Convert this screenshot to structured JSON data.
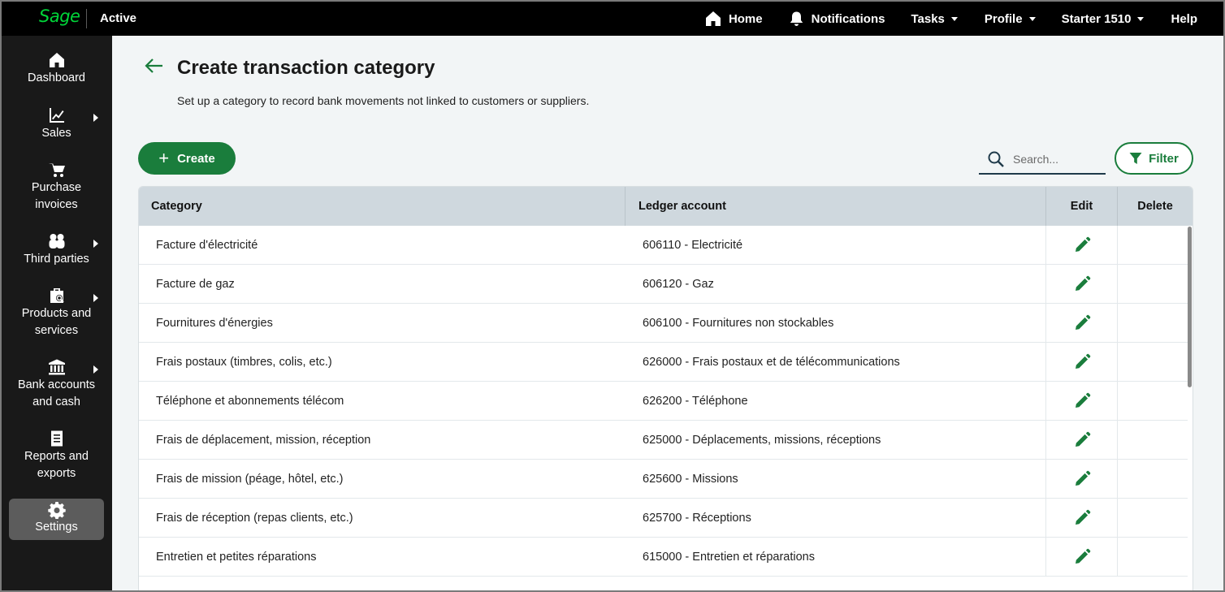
{
  "app": {
    "logo_text": "Sage",
    "state_label": "Active",
    "brand_color": "#00d639",
    "accent_color": "#1a7d3c"
  },
  "topnav": {
    "home": "Home",
    "notifications": "Notifications",
    "tasks": "Tasks",
    "profile": "Profile",
    "company": "Starter 1510",
    "help": "Help"
  },
  "sidebar": {
    "items": [
      {
        "label": "Dashboard",
        "icon": "home-icon"
      },
      {
        "label": "Sales",
        "icon": "chart-icon"
      },
      {
        "label": "Purchase invoices",
        "icon": "cart-icon"
      },
      {
        "label": "Third parties",
        "icon": "people-icon"
      },
      {
        "label": "Products and services",
        "icon": "products-icon"
      },
      {
        "label": "Bank accounts and cash",
        "icon": "bank-icon"
      },
      {
        "label": "Reports and exports",
        "icon": "document-icon"
      },
      {
        "label": "Settings",
        "icon": "gear-icon"
      }
    ]
  },
  "page": {
    "title": "Create transaction category",
    "subtitle": "Set up a category to record bank movements not linked to customers or suppliers."
  },
  "toolbar": {
    "create_label": "Create",
    "search_placeholder": "Search...",
    "filter_label": "Filter"
  },
  "table": {
    "headers": {
      "category": "Category",
      "ledger": "Ledger account",
      "edit": "Edit",
      "delete": "Delete"
    },
    "rows": [
      {
        "category": "Facture d'électricité",
        "ledger": "606110 - Electricité"
      },
      {
        "category": "Facture de gaz",
        "ledger": "606120 - Gaz"
      },
      {
        "category": "Fournitures d'énergies",
        "ledger": "606100 - Fournitures non stockables"
      },
      {
        "category": "Frais postaux (timbres, colis, etc.)",
        "ledger": "626000 - Frais postaux et de télécommunications"
      },
      {
        "category": "Téléphone et abonnements télécom",
        "ledger": "626200 - Téléphone"
      },
      {
        "category": "Frais de déplacement, mission, réception",
        "ledger": "625000 - Déplacements, missions, réceptions"
      },
      {
        "category": "Frais de mission (péage, hôtel, etc.)",
        "ledger": "625600 - Missions"
      },
      {
        "category": "Frais de réception (repas clients, etc.)",
        "ledger": "625700 - Réceptions"
      },
      {
        "category": "Entretien et petites réparations",
        "ledger": "615000 - Entretien et réparations"
      }
    ]
  }
}
